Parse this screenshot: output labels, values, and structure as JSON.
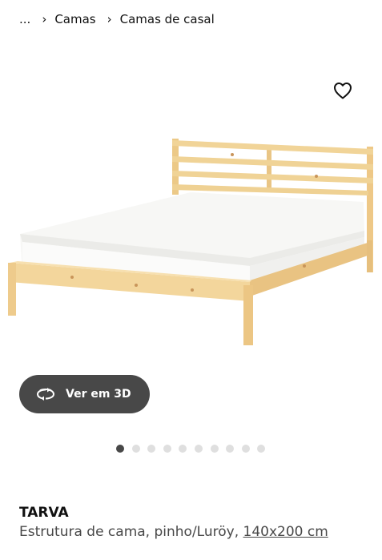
{
  "breadcrumb": {
    "ellipsis": "...",
    "items": [
      "Camas",
      "Camas de casal"
    ],
    "separator": "›"
  },
  "favorite": {
    "icon": "heart-outline-icon"
  },
  "image": {
    "alt": ""
  },
  "viewer_3d": {
    "label": "Ver em 3D",
    "icon": "rotate-3d-icon"
  },
  "carousel": {
    "total": 10,
    "active": 1
  },
  "product": {
    "name": "TARVA",
    "description": "Estrutura de cama, pinho/Luröy,",
    "size": "140x200 cm"
  },
  "colors": {
    "pill": "#484848",
    "dot_active": "#484848",
    "dot_inactive": "#dfdfdf",
    "wood": "#f2d69a"
  }
}
